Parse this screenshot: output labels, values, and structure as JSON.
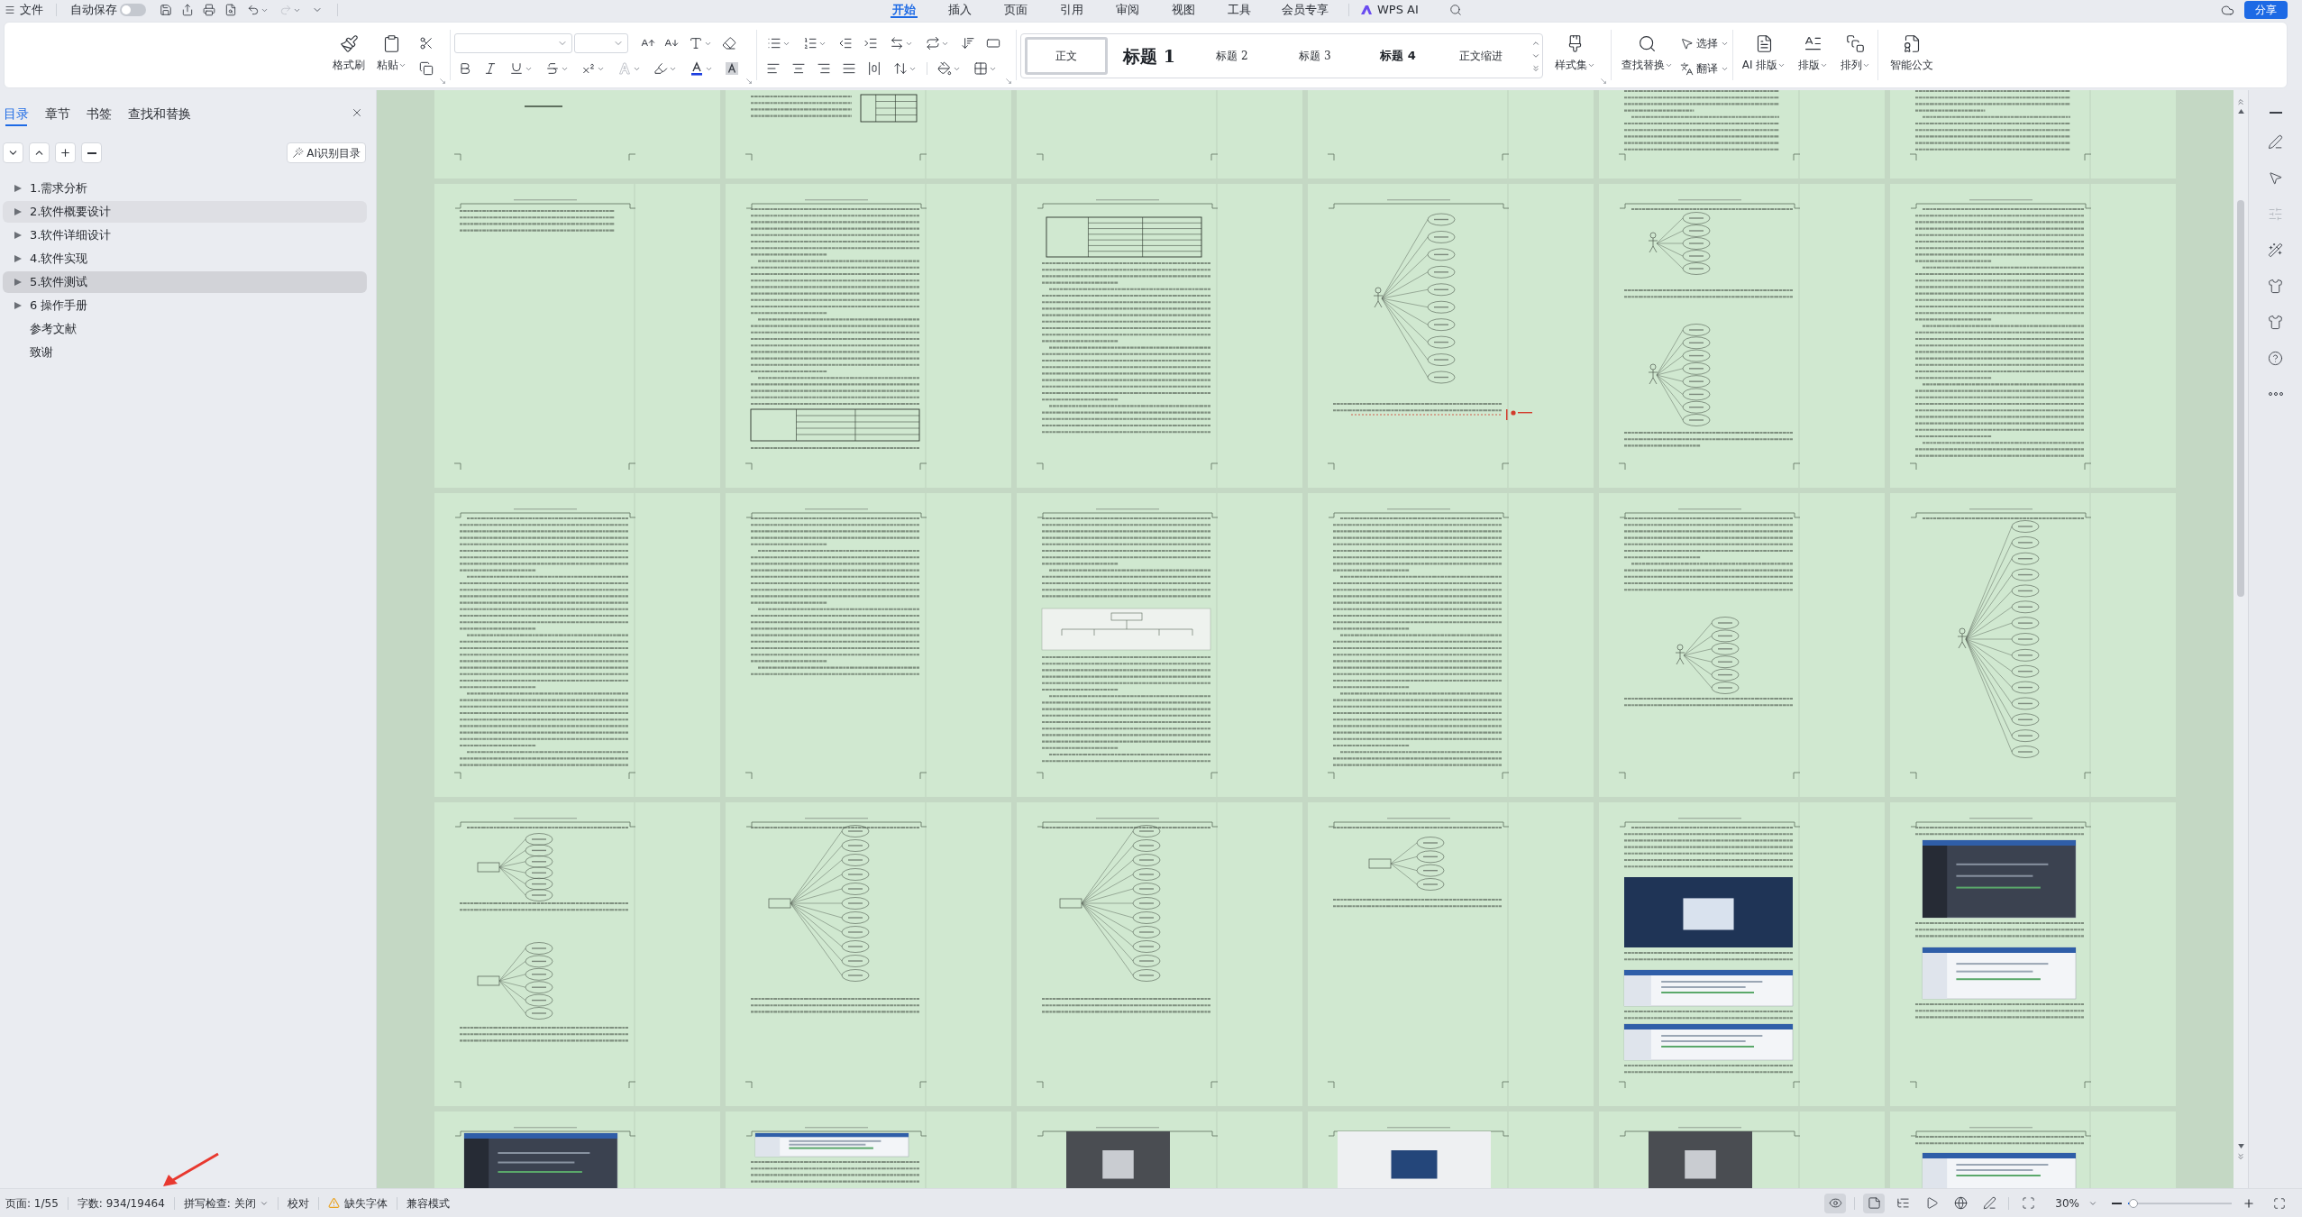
{
  "menu_bar": {
    "file_menu": "文件",
    "autosave": {
      "label": "自动保存",
      "on": false
    },
    "redo": {
      "disabled": true
    },
    "tabs": [
      {
        "label": "开始",
        "selected": true
      },
      {
        "label": "插入",
        "selected": false
      },
      {
        "label": "页面",
        "selected": false
      },
      {
        "label": "引用",
        "selected": false
      },
      {
        "label": "审阅",
        "selected": false
      },
      {
        "label": "视图",
        "selected": false
      },
      {
        "label": "工具",
        "selected": false
      },
      {
        "label": "会员专享",
        "selected": false
      }
    ],
    "ai_tab": "WPS AI",
    "share_button": "分享"
  },
  "ribbon": {
    "clipboard": [
      {
        "label": "格式刷",
        "dropdown": false
      },
      {
        "label": "粘贴",
        "dropdown": true
      }
    ],
    "text_effect": {
      "disabled": true
    },
    "styles": [
      {
        "label": "正文",
        "kind": "body",
        "selected": true
      },
      {
        "label": "标题 1",
        "kind": "heading1",
        "selected": false
      },
      {
        "label": "标题 2",
        "kind": "heading2",
        "selected": false
      },
      {
        "label": "标题 3",
        "kind": "heading3",
        "selected": false
      },
      {
        "label": "标题 4",
        "kind": "heading4",
        "selected": false
      },
      {
        "label": "正文缩进",
        "kind": "indent",
        "selected": false
      }
    ],
    "style_set": {
      "label": "样式集",
      "dropdown": true
    },
    "find_replace": {
      "label": "查找替换",
      "dropdown": true
    },
    "select_translate": [
      {
        "label": "选择",
        "dropdown": true
      },
      {
        "label": "翻译",
        "dropdown": true
      }
    ],
    "layout_tools": [
      {
        "label": "AI 排版",
        "dropdown": true
      },
      {
        "label": "排版",
        "dropdown": true
      },
      {
        "label": "排列",
        "dropdown": true
      }
    ],
    "smart_document": {
      "label": "智能公文",
      "dropdown": false
    }
  },
  "sidebar": {
    "tabs": [
      {
        "label": "目录",
        "selected": true
      },
      {
        "label": "章节",
        "selected": false
      },
      {
        "label": "书签",
        "selected": false
      },
      {
        "label": "查找和替换",
        "selected": false
      }
    ],
    "ai_button": "AI识别目录",
    "outline": [
      {
        "label": "1.需求分析",
        "expandable": true,
        "expanded": false,
        "selected": false,
        "hovered": false
      },
      {
        "label": "2.软件概要设计",
        "expandable": true,
        "expanded": false,
        "selected": false,
        "hovered": true
      },
      {
        "label": "3.软件详细设计",
        "expandable": true,
        "expanded": false,
        "selected": false,
        "hovered": false
      },
      {
        "label": "4.软件实现",
        "expandable": true,
        "expanded": false,
        "selected": false,
        "hovered": false
      },
      {
        "label": "5.软件测试",
        "expandable": true,
        "expanded": false,
        "selected": true,
        "hovered": false
      },
      {
        "label": "6 操作手册",
        "expandable": true,
        "expanded": false,
        "selected": false,
        "hovered": false
      },
      {
        "label": "参考文献",
        "expandable": false,
        "selected": false,
        "hovered": false
      },
      {
        "label": "致谢",
        "expandable": false,
        "selected": false,
        "hovered": false
      }
    ]
  },
  "pages": [
    {
      "kind": "cover"
    },
    {
      "kind": "signature"
    },
    {
      "kind": "blank"
    },
    {
      "kind": "blank"
    },
    {
      "kind": "toc"
    },
    {
      "kind": "toc"
    },
    {
      "kind": "tocend"
    },
    {
      "kind": "texttable"
    },
    {
      "kind": "tabletext"
    },
    {
      "kind": "mindmap"
    },
    {
      "kind": "mindmaps"
    },
    {
      "kind": "text"
    },
    {
      "kind": "text"
    },
    {
      "kind": "halftext"
    },
    {
      "kind": "diagram"
    },
    {
      "kind": "text"
    },
    {
      "kind": "textmindmap"
    },
    {
      "kind": "tallmindmap"
    },
    {
      "kind": "twomindmaps"
    },
    {
      "kind": "mindmaptext"
    },
    {
      "kind": "mindmaptext"
    },
    {
      "kind": "smallmindmap"
    },
    {
      "kind": "photoscreens"
    },
    {
      "kind": "screens"
    },
    {
      "kind": "darkscreen"
    },
    {
      "kind": "lightscreen"
    },
    {
      "kind": "photo"
    },
    {
      "kind": "book"
    },
    {
      "kind": "photo"
    },
    {
      "kind": "textscreen"
    }
  ],
  "right_toolbar": [
    {
      "disabled": false
    },
    {
      "disabled": false
    },
    {
      "disabled": false
    },
    {
      "disabled": true
    },
    {
      "disabled": false
    },
    {
      "disabled": false
    },
    {
      "disabled": false
    },
    {
      "disabled": false
    },
    {
      "disabled": false
    }
  ],
  "status_bar": {
    "items": [
      {
        "kind": "text",
        "label": "页面: 1/55"
      },
      {
        "kind": "text",
        "label": "字数: 934/19464"
      },
      {
        "kind": "dropdown",
        "label": "拼写检查: 关闭"
      },
      {
        "kind": "text",
        "label": "校对"
      },
      {
        "kind": "warning",
        "label": "缺失字体"
      },
      {
        "kind": "text",
        "label": "兼容模式"
      }
    ],
    "eye_protection": {
      "on": true
    },
    "view_modes": [
      {
        "selected": true
      },
      {
        "selected": false
      },
      {
        "selected": false
      },
      {
        "selected": false
      },
      {
        "selected": false
      }
    ],
    "zoom": {
      "value": "30%",
      "level": 0.05
    }
  }
}
